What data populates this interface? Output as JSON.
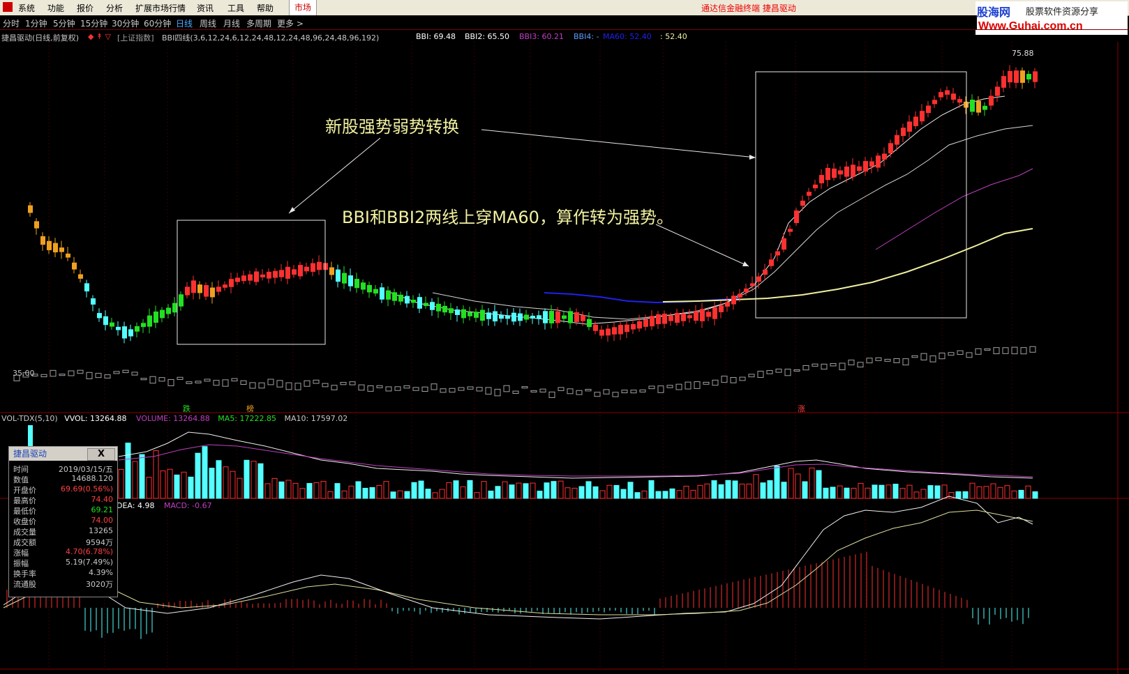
{
  "menu": {
    "items": [
      "系统",
      "功能",
      "报价",
      "分析",
      "扩展市场行情",
      "资讯",
      "工具",
      "帮助"
    ],
    "market_tab": "市场",
    "title": "通达信金融终端  捷昌驱动"
  },
  "site_logo": {
    "name": "股海网",
    "slogan": "股票软件资源分享",
    "url": "Www.Guhai.com.cn"
  },
  "periods": {
    "items": [
      "分时",
      "1分钟",
      "5分钟",
      "15分钟",
      "30分钟",
      "60分钟",
      "日线",
      "周线",
      "月线",
      "多周期",
      "更多 >"
    ],
    "active": "日线"
  },
  "info": {
    "stock": "捷昌驱动(日线,前复权)",
    "index_ref": "[上证指数]",
    "indicator": "BBI四线(3,6,12,24,6,12,24,48,12,24,48,96,24,48,96,192)",
    "bbi": "BBI: 69.48",
    "bbi2": "BBI2: 65.50",
    "bbi3": "BBI3: 60.21",
    "bbi4": "BBI4: -",
    "ma60": "MA60: 52.40",
    "ma60b": ": 52.40"
  },
  "price_labels": {
    "high": "75.88",
    "low": "35.00"
  },
  "markers": {
    "m1": "跌",
    "m2": "榜",
    "m3": "涨"
  },
  "volume": {
    "header": "VOL-TDX(5,10)",
    "vvol": "VVOL: 13264.88",
    "volume": "VOLUME: 13264.88",
    "ma5": "MA5: 17222.85",
    "ma10": "MA10: 17597.02"
  },
  "macd": {
    "dea": "DEA: 4.98",
    "macd": "MACD: -0.67"
  },
  "annotations": {
    "a1": "新股强势弱势转换",
    "a2": "BBI和BBI2两线上穿MA60，算作转为强势。"
  },
  "popup": {
    "title": "捷昌驱动",
    "close": "X",
    "rows": [
      {
        "label": "时间",
        "value": "2019/03/15/五"
      },
      {
        "label": "数值",
        "value": "14688.120"
      },
      {
        "label": "开盘价",
        "value": "69.69(0.56%)"
      },
      {
        "label": "最高价",
        "value": "74.40"
      },
      {
        "label": "最低价",
        "value": "69.21"
      },
      {
        "label": "收盘价",
        "value": "74.00"
      },
      {
        "label": "成交量",
        "value": "13265"
      },
      {
        "label": "成交额",
        "value": "9594万"
      },
      {
        "label": "涨幅",
        "value": "4.70(6.78%)"
      },
      {
        "label": "振幅",
        "value": "5.19(7.49%)"
      },
      {
        "label": "换手率",
        "value": "4.39%"
      },
      {
        "label": "流通股",
        "value": "3020万"
      }
    ]
  },
  "colors": {
    "up": "#ff3030",
    "down": "#22e022",
    "cyan": "#54ffff",
    "orange": "#f0a020",
    "yellow": "#f0f060",
    "purple": "#c040c0",
    "blue": "#2020f0"
  }
}
